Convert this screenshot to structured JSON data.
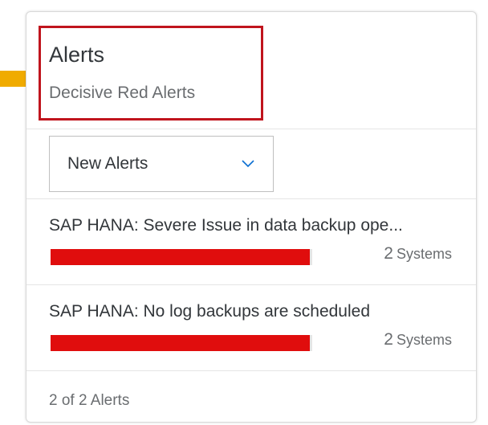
{
  "card": {
    "title": "Alerts",
    "subtitle": "Decisive Red Alerts"
  },
  "filter": {
    "selected": "New Alerts",
    "icon": "chevron-down-icon"
  },
  "alerts": [
    {
      "text": "SAP HANA: Severe Issue in data backup ope...",
      "count": "2",
      "unit": "Systems",
      "bar_fraction": 0.99
    },
    {
      "text": "SAP HANA: No log backups are scheduled",
      "count": "2",
      "unit": "Systems",
      "bar_fraction": 0.99
    }
  ],
  "footer": {
    "text": "2 of 2 Alerts"
  },
  "colors": {
    "bar": "#e00d0d",
    "highlight_box": "#c0141d",
    "callout_arrow": "#f0ab00",
    "chevron": "#0a6ed1"
  }
}
